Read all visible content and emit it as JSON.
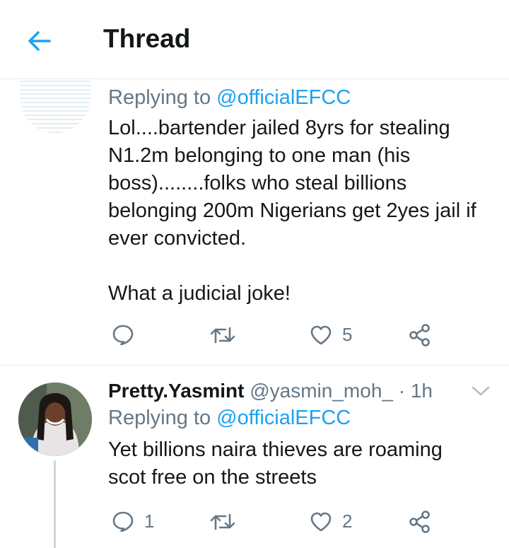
{
  "header": {
    "title": "Thread"
  },
  "tweets": [
    {
      "replying_prefix": "Replying to",
      "replying_handle": "@officialEFCC",
      "text": "Lol....bartender jailed 8yrs for stealing\nN1.2m belonging to one man (his\nboss)........folks who steal billions\nbelonging 200m Nigerians get 2yes jail if\never convicted.\n\nWhat a judicial joke!",
      "reply_count": "",
      "like_count": "5"
    },
    {
      "display_name": "Pretty.Yasmint",
      "handle": "@yasmin_moh_",
      "separator": "·",
      "time": "1h",
      "replying_prefix": "Replying to",
      "replying_handle": "@officialEFCC",
      "text": "Yet billions naira thieves are roaming\nscot free on the streets",
      "reply_count": "1",
      "like_count": "2"
    }
  ],
  "icons": {
    "back": "arrow-left-icon",
    "reply": "reply-icon",
    "retweet": "retweet-icon",
    "like": "heart-icon",
    "share": "share-icon",
    "more": "chevron-down-icon"
  },
  "colors": {
    "accent": "#1da1f2",
    "text": "#14171a",
    "secondary": "#657786",
    "border": "#e6ecf0"
  }
}
